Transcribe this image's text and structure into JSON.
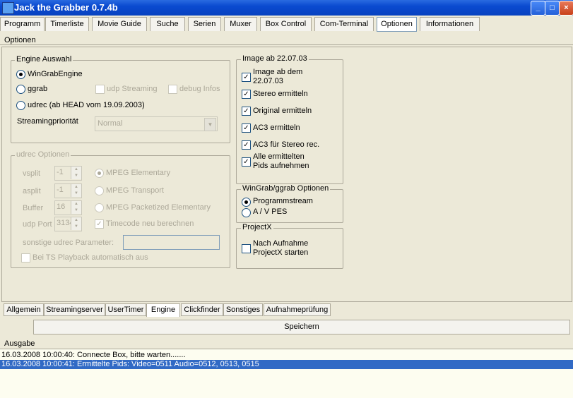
{
  "window": {
    "title": "Jack the Grabber 0.7.4b",
    "min": "_",
    "max": "□",
    "close": "×"
  },
  "menu_tabs": [
    "Programm",
    "Timerliste",
    "Movie Guide",
    "Suche",
    "Serien",
    "Muxer",
    "Box Control",
    "Com-Terminal",
    "Optionen",
    "Informationen"
  ],
  "section_title": "Optionen",
  "engine": {
    "title": "Engine Auswahl",
    "wingrab": "WinGrabEngine",
    "ggrab": "ggrab",
    "udp_streaming": "udp Streaming",
    "debug_infos": "debug Infos",
    "udrec": "udrec (ab HEAD vom 19.09.2003)",
    "priority_label": "Streamingpriorität",
    "priority_value": "Normal"
  },
  "udrec": {
    "title": "udrec Optionen",
    "vsplit_label": "vsplit",
    "vsplit": "-1",
    "asplit_label": "asplit",
    "asplit": "-1",
    "buffer_label": "Buffer",
    "buffer": "16",
    "udp_port_label": "udp Port",
    "udp_port": "31341",
    "mpeg_elementary": "MPEG Elementary",
    "mpeg_transport": "MPEG Transport",
    "mpeg_packetized": "MPEG Packetized Elementary",
    "timecode": "Timecode neu berechnen",
    "other_params": "sonstige udrec Parameter:",
    "ts_playback": "Bei TS Playback automatisch aus"
  },
  "image": {
    "title": "Image ab 22.07.03",
    "opt1": [
      "Image ab dem",
      "22.07.03"
    ],
    "opt2": "Stereo ermitteln",
    "opt3": "Original ermitteln",
    "opt4": "AC3 ermitteln",
    "opt5": "AC3 für Stereo rec.",
    "opt6": [
      "Alle ermittelten",
      "Pids aufnehmen"
    ]
  },
  "wingrab": {
    "title": "WinGrab/ggrab Optionen",
    "programmstream": "Programmstream",
    "avpes": "A / V PES"
  },
  "projectx": {
    "title": "ProjectX",
    "opt": [
      "Nach Aufnahme",
      "ProjectX starten"
    ]
  },
  "bottom_tabs": [
    "Allgemein",
    "Streamingserver",
    "UserTimer",
    "Engine",
    "Clickfinder",
    "Sonstiges",
    "Aufnahmeprüfung"
  ],
  "save": "Speichern",
  "ausgabe": "Ausgabe",
  "log": [
    "16.03.2008 10:00:40: Connecte Box, bitte warten.......",
    "16.03.2008 10:00:41: Ermittelte Pids: Video=0511 Audio=0512, 0513, 0515"
  ],
  "check_mark": "✓"
}
